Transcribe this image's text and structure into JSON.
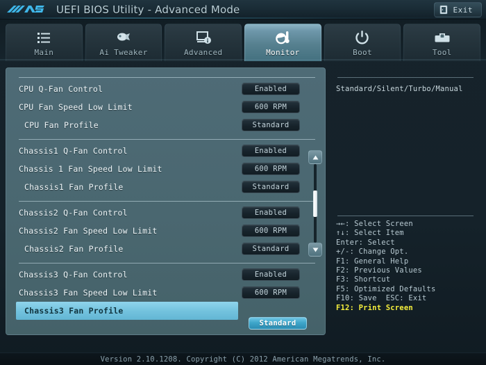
{
  "titlebar": {
    "logo_alt": "ASUS",
    "title": "UEFI BIOS Utility - Advanced Mode",
    "exit_label": "Exit",
    "exit_icon": "exit-door-icon"
  },
  "tabs": [
    {
      "label": "Main",
      "icon": "list-icon",
      "active": false
    },
    {
      "label": "Ai Tweaker",
      "icon": "turbo-icon",
      "active": false
    },
    {
      "label": "Advanced",
      "icon": "monitor-info-icon",
      "active": false
    },
    {
      "label": "Monitor",
      "icon": "thermometer-icon",
      "active": true
    },
    {
      "label": "Boot",
      "icon": "power-icon",
      "active": false
    },
    {
      "label": "Tool",
      "icon": "toolbox-icon",
      "active": false
    }
  ],
  "settings": {
    "groups": [
      {
        "name": "cpu-fan-group",
        "rows": [
          {
            "label": "CPU Q-Fan Control",
            "value": "Enabled",
            "indent": false,
            "selected": false
          },
          {
            "label": "CPU Fan Speed Low Limit",
            "value": "600 RPM",
            "indent": false,
            "selected": false
          },
          {
            "label": "CPU Fan Profile",
            "value": "Standard",
            "indent": true,
            "selected": false
          }
        ]
      },
      {
        "name": "chassis1-fan-group",
        "rows": [
          {
            "label": "Chassis1 Q-Fan Control",
            "value": "Enabled",
            "indent": false,
            "selected": false
          },
          {
            "label": "Chassis 1 Fan Speed Low Limit",
            "value": "600 RPM",
            "indent": false,
            "selected": false
          },
          {
            "label": "Chassis1 Fan Profile",
            "value": "Standard",
            "indent": true,
            "selected": false
          }
        ]
      },
      {
        "name": "chassis2-fan-group",
        "rows": [
          {
            "label": "Chassis2 Q-Fan Control",
            "value": "Enabled",
            "indent": false,
            "selected": false
          },
          {
            "label": "Chassis2 Fan Speed Low Limit",
            "value": "600 RPM",
            "indent": false,
            "selected": false
          },
          {
            "label": "Chassis2 Fan Profile",
            "value": "Standard",
            "indent": true,
            "selected": false
          }
        ]
      },
      {
        "name": "chassis3-fan-group",
        "rows": [
          {
            "label": "Chassis3 Q-Fan Control",
            "value": "Enabled",
            "indent": false,
            "selected": false
          },
          {
            "label": "Chassis3 Fan Speed Low Limit",
            "value": "600 RPM",
            "indent": false,
            "selected": false
          },
          {
            "label": "Chassis3 Fan Profile",
            "value": "Standard",
            "indent": true,
            "selected": true
          }
        ]
      }
    ]
  },
  "scrollbar": {
    "up_icon": "triangle-up-icon",
    "down_icon": "triangle-down-icon"
  },
  "info": {
    "help_text": "Standard/Silent/Turbo/Manual",
    "key_legend": [
      {
        "text": "→←: Select Screen",
        "highlight": false
      },
      {
        "text": "↑↓: Select Item",
        "highlight": false
      },
      {
        "text": "Enter: Select",
        "highlight": false
      },
      {
        "text": "+/-: Change Opt.",
        "highlight": false
      },
      {
        "text": "F1: General Help",
        "highlight": false
      },
      {
        "text": "F2: Previous Values",
        "highlight": false
      },
      {
        "text": "F3: Shortcut",
        "highlight": false
      },
      {
        "text": "F5: Optimized Defaults",
        "highlight": false
      },
      {
        "text": "F10: Save  ESC: Exit",
        "highlight": false
      },
      {
        "text": "F12: Print Screen",
        "highlight": true
      }
    ]
  },
  "footer": {
    "text": "Version 2.10.1208. Copyright (C) 2012 American Megatrends, Inc."
  },
  "colors": {
    "accent_cyan": "#74c3de",
    "highlight_yellow": "#f5ef3c",
    "panel_slate": "#4a6770",
    "window_dark": "#16232b"
  }
}
